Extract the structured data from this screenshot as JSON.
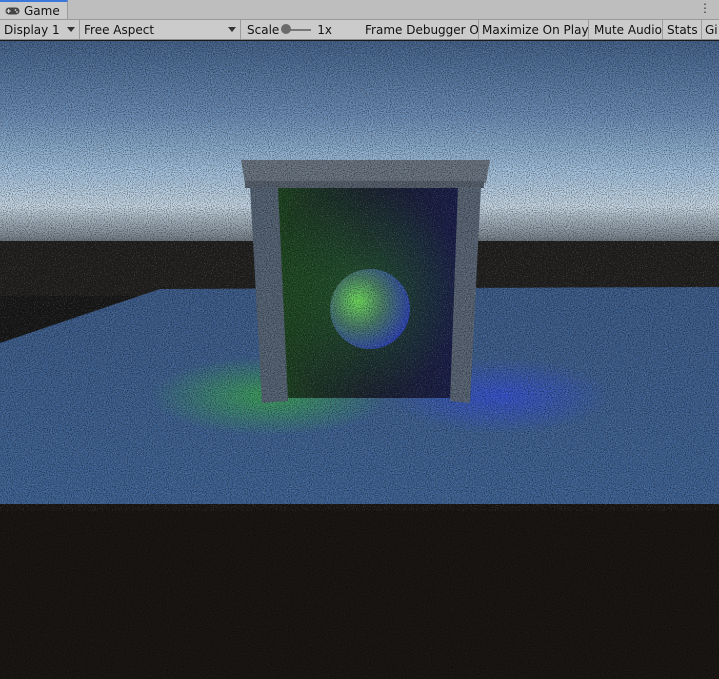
{
  "tab": {
    "title": "Game",
    "icon": "gamepad-icon"
  },
  "menu_icon": "kebab-menu-icon",
  "toolbar": {
    "display": "Display 1",
    "aspect": "Free Aspect",
    "scale_label": "Scale",
    "scale_value": "1x",
    "scale_level": 1,
    "frame_debugger": "Frame Debugger On",
    "maximize": "Maximize On Play",
    "mute": "Mute Audio",
    "stats": "Stats",
    "gizmos": "Gi"
  },
  "colors": {
    "chrome": "#cbcbcb",
    "tab_accent": "#3a79d9",
    "sky_top": "#4f6e96",
    "horizon": "#a8c6e0",
    "floor": "#3f5f8c",
    "ground": "#1b1714",
    "green_light": "#35d22e",
    "blue_light": "#2f48ff"
  }
}
